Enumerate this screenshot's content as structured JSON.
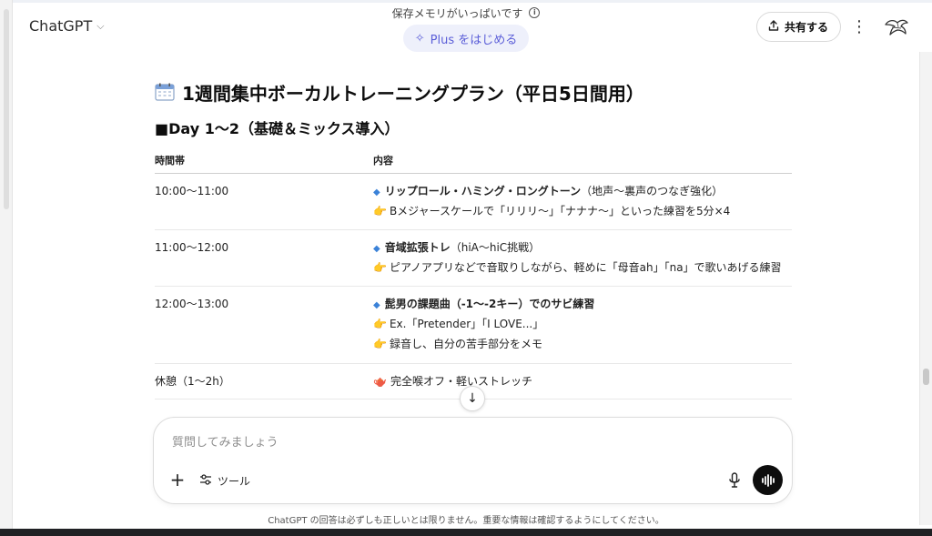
{
  "header": {
    "model_label": "ChatGPT",
    "memory_notice": "保存メモリがいっぱいです",
    "upgrade_label": "Plus をはじめる",
    "share_label": "共有する"
  },
  "content": {
    "title": "1週間集中ボーカルトレーニングプラン（平日5日間用）",
    "section_title": "■Day 1〜2（基礎＆ミックス導入）",
    "table": {
      "headers": [
        "時間帯",
        "内容"
      ],
      "rows": [
        {
          "time": "10:00〜11:00",
          "main_bold": "リップロール・ハミング・ロングトーン",
          "main_rest": "（地声〜裏声のつなぎ強化）",
          "notes": [
            "Bメジャースケールで「リリリ〜」「ナナナ〜」といった練習を5分×4"
          ]
        },
        {
          "time": "11:00〜12:00",
          "main_bold": "音域拡張トレ",
          "main_rest": "（hiA〜hiC挑戦）",
          "notes": [
            "ピアノアプリなどで音取りしながら、軽めに「母音ah」「na」で歌いあげる練習"
          ]
        },
        {
          "time": "12:00〜13:00",
          "main_bold": "髭男の課題曲（-1〜-2キー）でのサビ練習",
          "main_rest": "",
          "notes": [
            "Ex.「Pretender」「I LOVE...」",
            "録音し、自分の苦手部分をメモ"
          ]
        },
        {
          "time": "休憩（1〜2h）",
          "main_bold": "",
          "main_rest": "完全喉オフ・軽いストレッチ",
          "notes": []
        }
      ]
    }
  },
  "composer": {
    "placeholder": "質問してみましょう",
    "tools_label": "ツール"
  },
  "footer": {
    "disclaimer": "ChatGPT の回答は必ずしも正しいとは限りません。重要な情報は確認するようにしてください。"
  },
  "icons": {
    "calendar": "calendar-icon",
    "diamond": "small-blue-diamond-icon",
    "hand": "backhand-index-pointing-right-icon",
    "teapot": "teapot-icon"
  },
  "colors": {
    "accent": "#5b5ed8",
    "accent_bg": "#eef0fb",
    "diamond": "#3b82d8"
  }
}
